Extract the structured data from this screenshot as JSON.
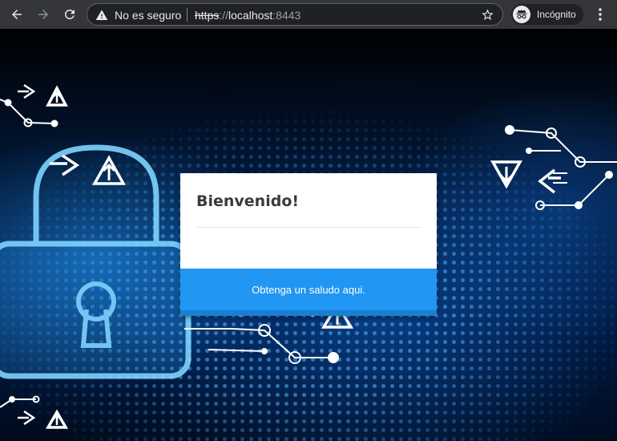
{
  "browser": {
    "security_label": "No es seguro",
    "url_scheme": "https",
    "url_separator": "://",
    "url_host": "localhost",
    "url_port": ":8443",
    "incognito_label": "Incógnito",
    "toolbar_color": "#35363a",
    "omnibox_color": "#202124"
  },
  "card": {
    "title": "Bienvenido!",
    "action_label": "Obtenga un saludo aqui.",
    "action_color": "#2196f3"
  },
  "background": {
    "theme_colors": [
      "#000000",
      "#01122a",
      "#1f97ff",
      "#56b4ff"
    ],
    "motif": [
      "padlock-icon",
      "circuit-lines",
      "warning-triangle-icons",
      "arrow-icons"
    ]
  }
}
